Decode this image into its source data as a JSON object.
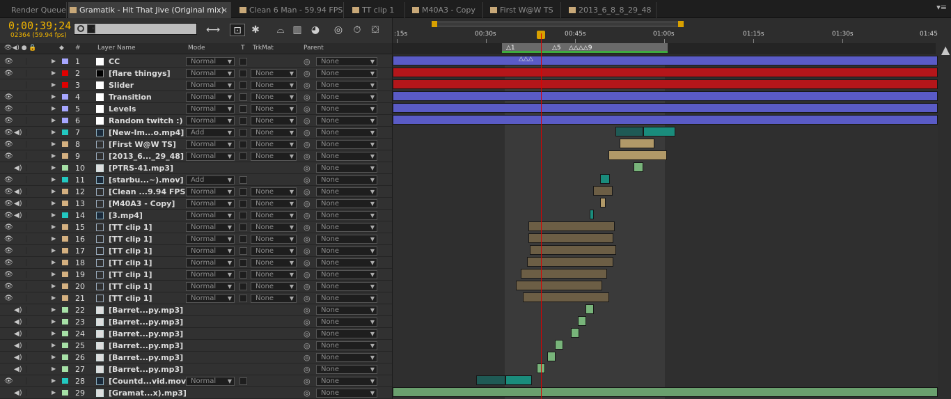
{
  "tabs": [
    {
      "label": "Render Queue",
      "active": false,
      "swatch": false
    },
    {
      "label": "Gramatik - Hit That Jive (Original mix)",
      "active": true,
      "swatch": true
    },
    {
      "label": "Clean 6 Man - 59.94 FPS",
      "active": false,
      "swatch": true
    },
    {
      "label": "TT clip 1",
      "active": false,
      "swatch": true
    },
    {
      "label": "M40A3 - Copy",
      "active": false,
      "swatch": true
    },
    {
      "label": "First W@W TS",
      "active": false,
      "swatch": true
    },
    {
      "label": "2013_6_8_8_29_48",
      "active": false,
      "swatch": true
    }
  ],
  "timecode": "0;00;39;24",
  "frames": "02364 (59.94 fps)",
  "columns": {
    "layer_name": "Layer Name",
    "mode": "Mode",
    "t": "T",
    "trkmat": "TrkMat",
    "parent": "Parent",
    "num": "#"
  },
  "ruler": {
    "labels": [
      ":15s",
      "00:30s",
      "00:45s",
      "01:00s",
      "01:15s",
      "01:30s",
      "01:45"
    ]
  },
  "markers": [
    "1",
    "5",
    "9",
    "2"
  ],
  "layers": [
    {
      "num": "1",
      "name": "CC",
      "label": "#a6a6ff",
      "icon": "solid",
      "mode": "Normal",
      "trkmat": "",
      "parent": "None"
    },
    {
      "num": "2",
      "name": "[flare thingys]",
      "label": "#e00000",
      "icon": "solid-black",
      "mode": "Normal",
      "trkmat": "None",
      "parent": "None"
    },
    {
      "num": "3",
      "name": "Slider",
      "label": "#e00000",
      "icon": "solid",
      "mode": "Normal",
      "trkmat": "None",
      "parent": "None"
    },
    {
      "num": "4",
      "name": "Transition",
      "label": "#a6a6ff",
      "icon": "solid",
      "mode": "Normal",
      "trkmat": "None",
      "parent": "None"
    },
    {
      "num": "5",
      "name": "Levels",
      "label": "#a6a6ff",
      "icon": "solid",
      "mode": "Normal",
      "trkmat": "None",
      "parent": "None"
    },
    {
      "num": "6",
      "name": "Random twitch :)",
      "label": "#a6a6ff",
      "icon": "solid",
      "mode": "Normal",
      "trkmat": "None",
      "parent": "None"
    },
    {
      "num": "7",
      "name": "[New-Im...o.mp4]",
      "label": "#22c8c0",
      "icon": "video",
      "mode": "Add",
      "trkmat": "None",
      "parent": "None"
    },
    {
      "num": "8",
      "name": "[First W@W TS]",
      "label": "#d4b080",
      "icon": "comp",
      "mode": "Normal",
      "trkmat": "None",
      "parent": "None"
    },
    {
      "num": "9",
      "name": "[2013_6..._29_48]",
      "label": "#d4b080",
      "icon": "comp",
      "mode": "Normal",
      "trkmat": "None",
      "parent": "None"
    },
    {
      "num": "10",
      "name": "[PTRS-41.mp3]",
      "label": "#a6e0a6",
      "icon": "audio",
      "mode": "",
      "trkmat": "",
      "parent": "None"
    },
    {
      "num": "11",
      "name": "[starbu...~).mov]",
      "label": "#22c8c0",
      "icon": "video",
      "mode": "Add",
      "trkmat": "",
      "parent": "None"
    },
    {
      "num": "12",
      "name": "[Clean ...9.94 FPS]",
      "label": "#d4b080",
      "icon": "comp",
      "mode": "Normal",
      "trkmat": "None",
      "parent": "None"
    },
    {
      "num": "13",
      "name": "[M40A3 - Copy]",
      "label": "#d4b080",
      "icon": "comp",
      "mode": "Normal",
      "trkmat": "None",
      "parent": "None"
    },
    {
      "num": "14",
      "name": "[3.mp4]",
      "label": "#22c8c0",
      "icon": "video",
      "mode": "Normal",
      "trkmat": "None",
      "parent": "None"
    },
    {
      "num": "15",
      "name": "[TT clip 1]",
      "label": "#d4b080",
      "icon": "comp",
      "mode": "Normal",
      "trkmat": "None",
      "parent": "None"
    },
    {
      "num": "16",
      "name": "[TT clip 1]",
      "label": "#d4b080",
      "icon": "comp",
      "mode": "Normal",
      "trkmat": "None",
      "parent": "None"
    },
    {
      "num": "17",
      "name": "[TT clip 1]",
      "label": "#d4b080",
      "icon": "comp",
      "mode": "Normal",
      "trkmat": "None",
      "parent": "None"
    },
    {
      "num": "18",
      "name": "[TT clip 1]",
      "label": "#d4b080",
      "icon": "comp",
      "mode": "Normal",
      "trkmat": "None",
      "parent": "None"
    },
    {
      "num": "19",
      "name": "[TT clip 1]",
      "label": "#d4b080",
      "icon": "comp",
      "mode": "Normal",
      "trkmat": "None",
      "parent": "None"
    },
    {
      "num": "20",
      "name": "[TT clip 1]",
      "label": "#d4b080",
      "icon": "comp",
      "mode": "Normal",
      "trkmat": "None",
      "parent": "None"
    },
    {
      "num": "21",
      "name": "[TT clip 1]",
      "label": "#d4b080",
      "icon": "comp",
      "mode": "Normal",
      "trkmat": "None",
      "parent": "None"
    },
    {
      "num": "22",
      "name": "[Barret...py.mp3]",
      "label": "#a6e0a6",
      "icon": "audio",
      "mode": "",
      "trkmat": "",
      "parent": "None"
    },
    {
      "num": "23",
      "name": "[Barret...py.mp3]",
      "label": "#a6e0a6",
      "icon": "audio",
      "mode": "",
      "trkmat": "",
      "parent": "None"
    },
    {
      "num": "24",
      "name": "[Barret...py.mp3]",
      "label": "#a6e0a6",
      "icon": "audio",
      "mode": "",
      "trkmat": "",
      "parent": "None"
    },
    {
      "num": "25",
      "name": "[Barret...py.mp3]",
      "label": "#a6e0a6",
      "icon": "audio",
      "mode": "",
      "trkmat": "",
      "parent": "None"
    },
    {
      "num": "26",
      "name": "[Barret...py.mp3]",
      "label": "#a6e0a6",
      "icon": "audio",
      "mode": "",
      "trkmat": "",
      "parent": "None"
    },
    {
      "num": "27",
      "name": "[Barret...py.mp3]",
      "label": "#a6e0a6",
      "icon": "audio",
      "mode": "",
      "trkmat": "",
      "parent": "None"
    },
    {
      "num": "28",
      "name": "[Countd...vid.mov]",
      "label": "#22c8c0",
      "icon": "video",
      "mode": "Normal",
      "trkmat": "",
      "parent": "None"
    },
    {
      "num": "29",
      "name": "[Gramat...x).mp3]",
      "label": "#a6e0a6",
      "icon": "audio",
      "mode": "",
      "trkmat": "",
      "parent": "None"
    }
  ]
}
